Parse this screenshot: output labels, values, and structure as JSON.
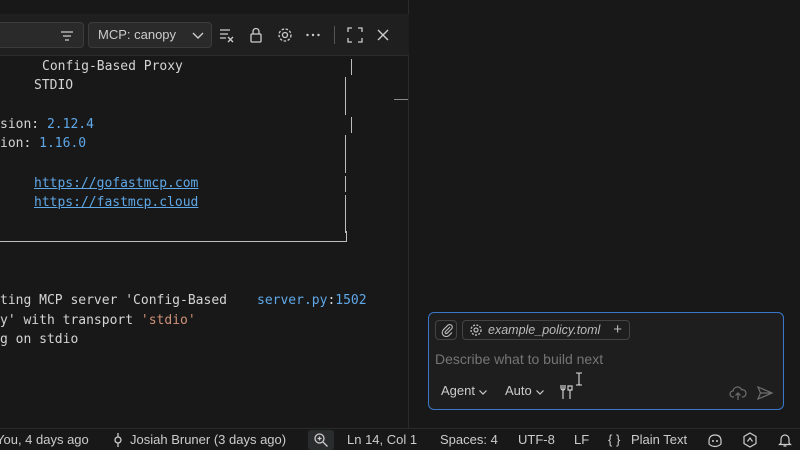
{
  "output": {
    "filter_placeholder": "",
    "channel": "MCP: canopy",
    "terminal": {
      "banner_name": "Config-Based Proxy",
      "banner_transport": "STDIO",
      "version_fastmcp_prefix": "sion: ",
      "version_fastmcp": "2.12.4",
      "version_mcp_prefix": "ion: ",
      "version_mcp": "1.16.0",
      "link_docs": "https://gofastmcp.com",
      "link_cloud": "https://fastmcp.cloud",
      "log1_prefix": "ting MCP server 'Config-Based",
      "log1_source_file": "server.py",
      "log1_source_sep": ":",
      "log1_source_line": "1502",
      "log2_prefix": "y' with transport ",
      "log2_string": "'stdio'",
      "log3": "g on stdio"
    }
  },
  "chat": {
    "context_file": "example_policy.toml",
    "input_placeholder": "Describe what to build next",
    "agent_label": "Agent",
    "model_label": "Auto"
  },
  "statusbar": {
    "blame_current": "You, 4 days ago",
    "blame_author": "Josiah Bruner (3 days ago)",
    "cursor_position": "Ln 14, Col 1",
    "indentation": "Spaces: 4",
    "encoding": "UTF-8",
    "eol": "LF",
    "language_braces": "{ }",
    "language": "Plain Text"
  },
  "colors": {
    "accent_blue": "#3b77c9",
    "link_blue": "#5fa8e8",
    "string_orange": "#ce9178",
    "background": "#181818"
  }
}
